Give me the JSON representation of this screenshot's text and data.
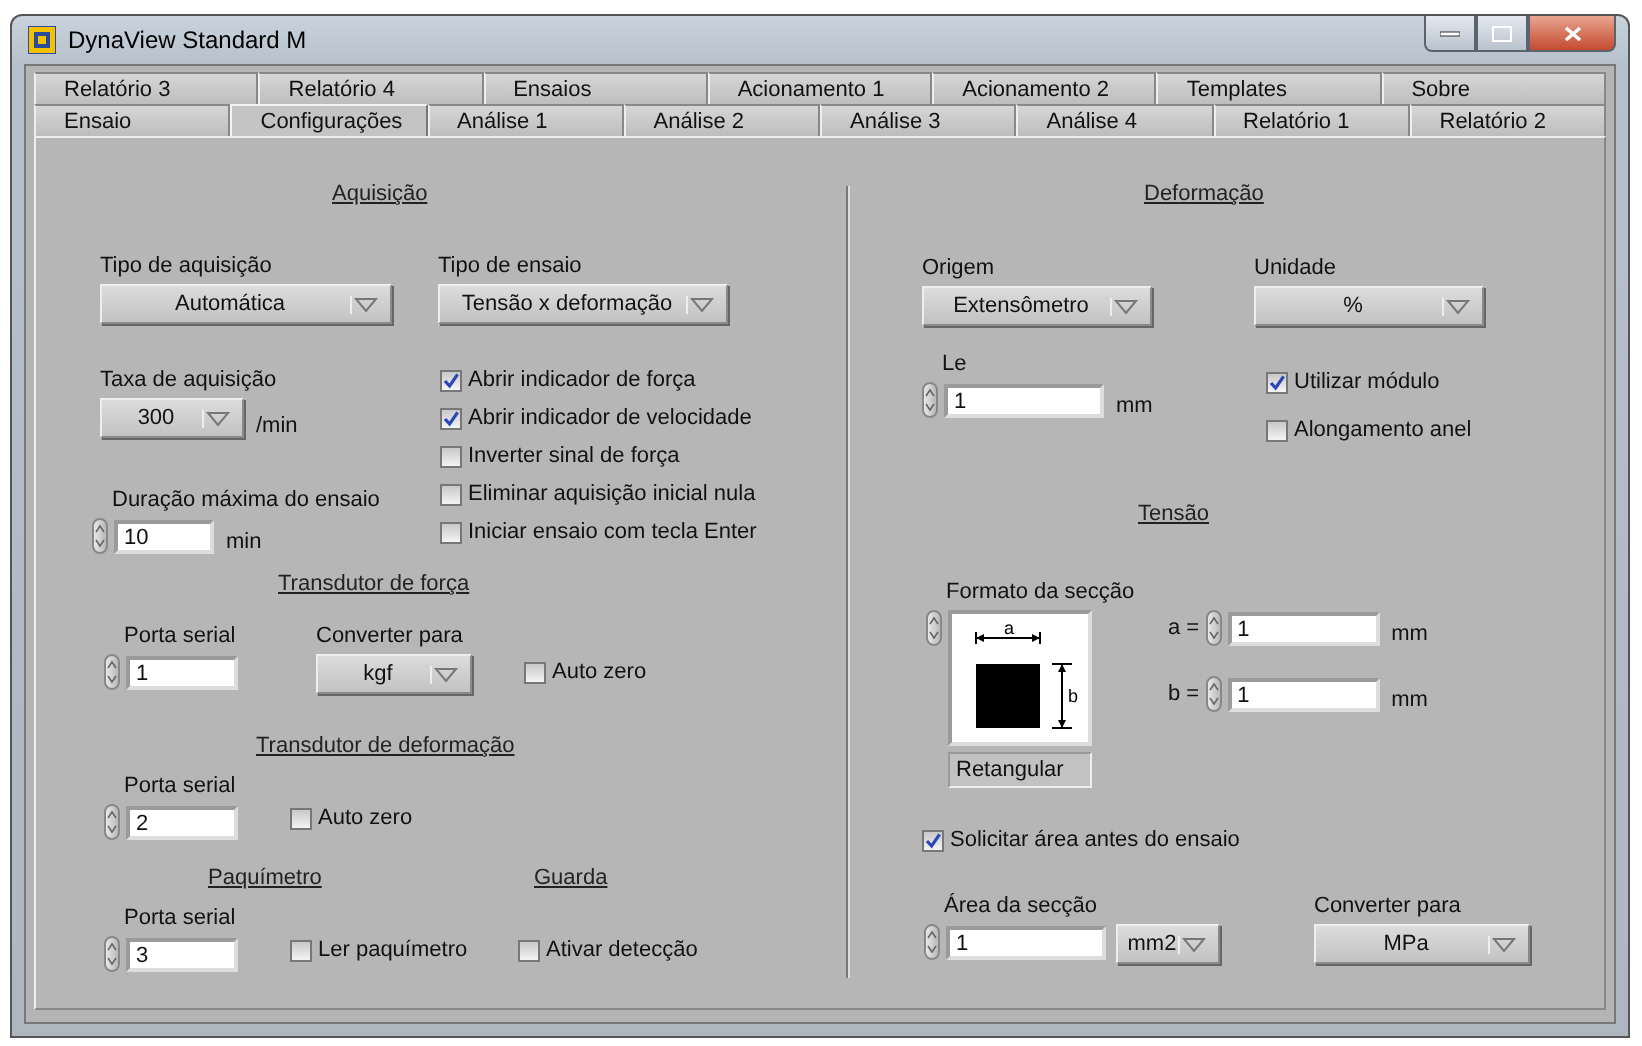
{
  "window": {
    "title": "DynaView Standard M"
  },
  "tab_rows": [
    [
      {
        "label": "Relatório 3",
        "selected": false
      },
      {
        "label": "Relatório 4",
        "selected": false
      },
      {
        "label": "Ensaios",
        "selected": false
      },
      {
        "label": "Acionamento 1",
        "selected": false
      },
      {
        "label": "Acionamento 2",
        "selected": false
      },
      {
        "label": "Templates",
        "selected": false
      },
      {
        "label": "Sobre",
        "selected": false
      }
    ],
    [
      {
        "label": "Ensaio",
        "selected": false
      },
      {
        "label": "Configurações",
        "selected": true
      },
      {
        "label": "Análise 1",
        "selected": false
      },
      {
        "label": "Análise 2",
        "selected": false
      },
      {
        "label": "Análise 3",
        "selected": false
      },
      {
        "label": "Análise 4",
        "selected": false
      },
      {
        "label": "Relatório 1",
        "selected": false
      },
      {
        "label": "Relatório 2",
        "selected": false
      }
    ]
  ],
  "controls": [
    {
      "kind": "heading",
      "label": "Aquisição"
    },
    {
      "kind": "dropdown",
      "label": "Tipo de aquisição",
      "value": "Automática"
    },
    {
      "kind": "dropdown",
      "label": "Tipo de ensaio",
      "value": "Tensão x deformação"
    },
    {
      "kind": "dropdown",
      "label": "Taxa de aquisição",
      "value": "300",
      "unit": "/min"
    },
    {
      "kind": "numeric",
      "label": "Duração máxima do ensaio",
      "value": "10",
      "unit": "min"
    },
    {
      "kind": "checkbox",
      "label": "Abrir indicador de força",
      "checked": true
    },
    {
      "kind": "checkbox",
      "label": "Abrir indicador de velocidade",
      "checked": true
    },
    {
      "kind": "checkbox",
      "label": "Inverter sinal de força",
      "checked": false
    },
    {
      "kind": "checkbox",
      "label": "Eliminar aquisição inicial nula",
      "checked": false
    },
    {
      "kind": "checkbox",
      "label": "Iniciar ensaio com tecla Enter",
      "checked": false
    },
    {
      "kind": "heading",
      "label": "Transdutor de força"
    },
    {
      "kind": "numeric",
      "label": "Porta serial",
      "value": "1"
    },
    {
      "kind": "dropdown",
      "label": "Converter para",
      "value": "kgf"
    },
    {
      "kind": "checkbox",
      "label": "Auto zero",
      "checked": false
    },
    {
      "kind": "heading",
      "label": "Transdutor de deformação"
    },
    {
      "kind": "numeric",
      "label": "Porta serial",
      "value": "2"
    },
    {
      "kind": "checkbox",
      "label": "Auto zero",
      "checked": false
    },
    {
      "kind": "heading",
      "label": "Paquímetro"
    },
    {
      "kind": "heading",
      "label": "Guarda"
    },
    {
      "kind": "numeric",
      "label": "Porta serial",
      "value": "3"
    },
    {
      "kind": "checkbox",
      "label": "Ler paquímetro",
      "checked": false
    },
    {
      "kind": "checkbox",
      "label": "Ativar detecção",
      "checked": false
    },
    {
      "kind": "heading",
      "label": "Deformação"
    },
    {
      "kind": "dropdown",
      "label": "Origem",
      "value": "Extensômetro"
    },
    {
      "kind": "dropdown",
      "label": "Unidade",
      "value": "%"
    },
    {
      "kind": "numeric",
      "label": "Le",
      "value": "1",
      "unit": "mm"
    },
    {
      "kind": "checkbox",
      "label": "Utilizar módulo",
      "checked": true
    },
    {
      "kind": "checkbox",
      "label": "Alongamento anel",
      "checked": false
    },
    {
      "kind": "heading",
      "label": "Tensão"
    },
    {
      "kind": "ring",
      "label": "Formato da secção",
      "value": "Retangular",
      "dimension_labels": [
        "a",
        "b"
      ]
    },
    {
      "kind": "numeric",
      "prefix": "a =",
      "value": "1",
      "unit": "mm"
    },
    {
      "kind": "numeric",
      "prefix": "b =",
      "value": "1",
      "unit": "mm"
    },
    {
      "kind": "checkbox",
      "label": "Solicitar área antes do ensaio",
      "checked": true
    },
    {
      "kind": "numeric",
      "label": "Área da secção",
      "value": "1"
    },
    {
      "kind": "dropdown",
      "value": "mm2"
    },
    {
      "kind": "dropdown",
      "label": "Converter para",
      "value": "MPa"
    }
  ]
}
